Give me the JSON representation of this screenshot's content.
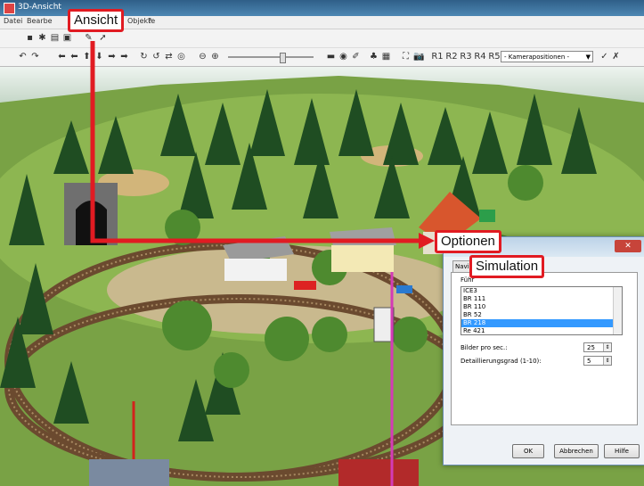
{
  "window": {
    "title": "3D-Ansicht"
  },
  "menu": {
    "items": [
      "Datei",
      "Bearbe",
      "Objekte",
      "?"
    ]
  },
  "toolbar": {
    "camera_select": {
      "value": "- Kamerapositionen -"
    },
    "camera_buttons": [
      "R1",
      "R2",
      "R3",
      "R4",
      "R5"
    ]
  },
  "callouts": {
    "ansicht": "Ansicht",
    "optionen": "Optionen",
    "simulation": "Simulation"
  },
  "dialog": {
    "tab_partial": "Navig",
    "field_label_partial": "Führ",
    "list_items": [
      "ICE3",
      "BR 111",
      "BR 110",
      "BR 52",
      "BR 218",
      "Re 421"
    ],
    "selected_item": "BR 218",
    "fps_label": "Bilder pro sec.:",
    "fps_value": "25",
    "detail_label": "Detaillierungsgrad (1-10):",
    "detail_value": "5",
    "ok_label": "OK",
    "cancel_label": "Abbrechen",
    "help_label": "Hilfe"
  },
  "colors": {
    "accent": "#e11b22",
    "selection": "#3399ff",
    "grass": "#7aa14a"
  }
}
